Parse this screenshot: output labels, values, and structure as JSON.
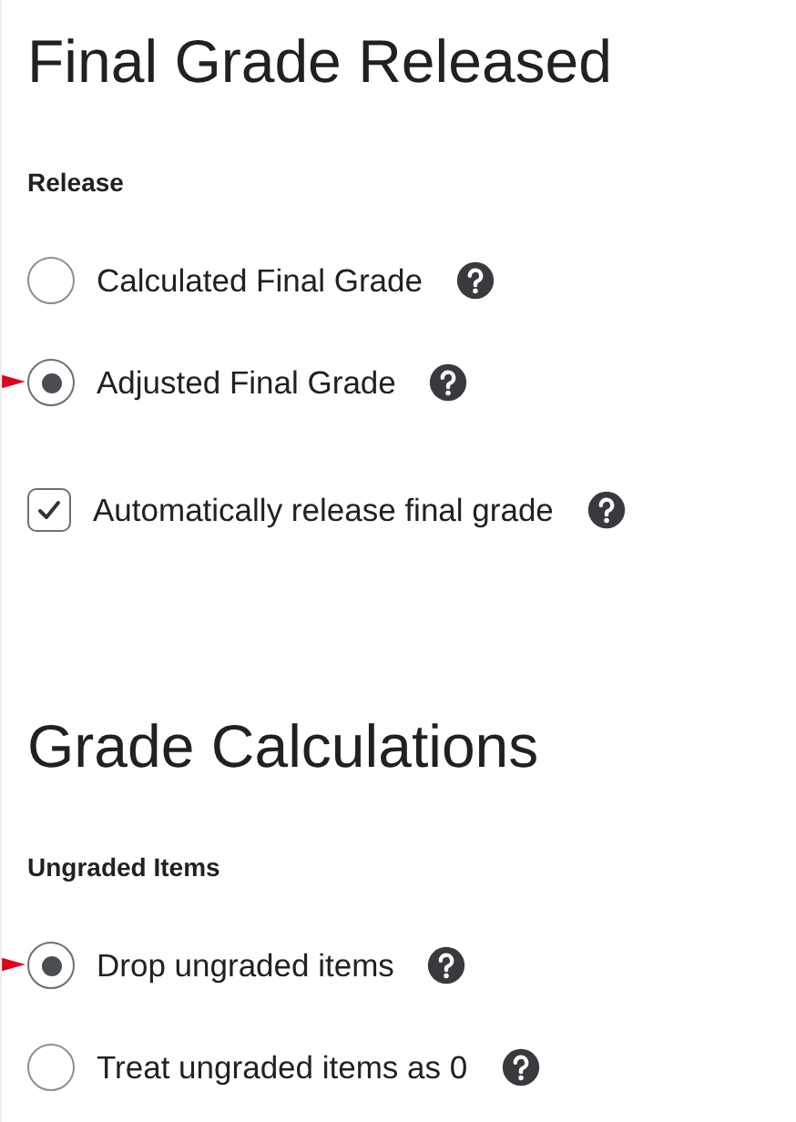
{
  "sections": [
    {
      "title": "Final Grade Released",
      "groups": [
        {
          "label": "Release",
          "items": [
            {
              "kind": "radio",
              "label": "Calculated Final Grade",
              "selected": false,
              "marked": false
            },
            {
              "kind": "radio",
              "label": "Adjusted Final Grade",
              "selected": true,
              "marked": true
            }
          ]
        },
        {
          "items": [
            {
              "kind": "checkbox",
              "label": "Automatically release final grade",
              "checked": true
            }
          ]
        }
      ]
    },
    {
      "title": "Grade Calculations",
      "groups": [
        {
          "label": "Ungraded Items",
          "items": [
            {
              "kind": "radio",
              "label": "Drop ungraded items",
              "selected": true,
              "marked": true
            },
            {
              "kind": "radio",
              "label": "Treat ungraded items as 0",
              "selected": false,
              "marked": false
            }
          ]
        }
      ]
    }
  ]
}
